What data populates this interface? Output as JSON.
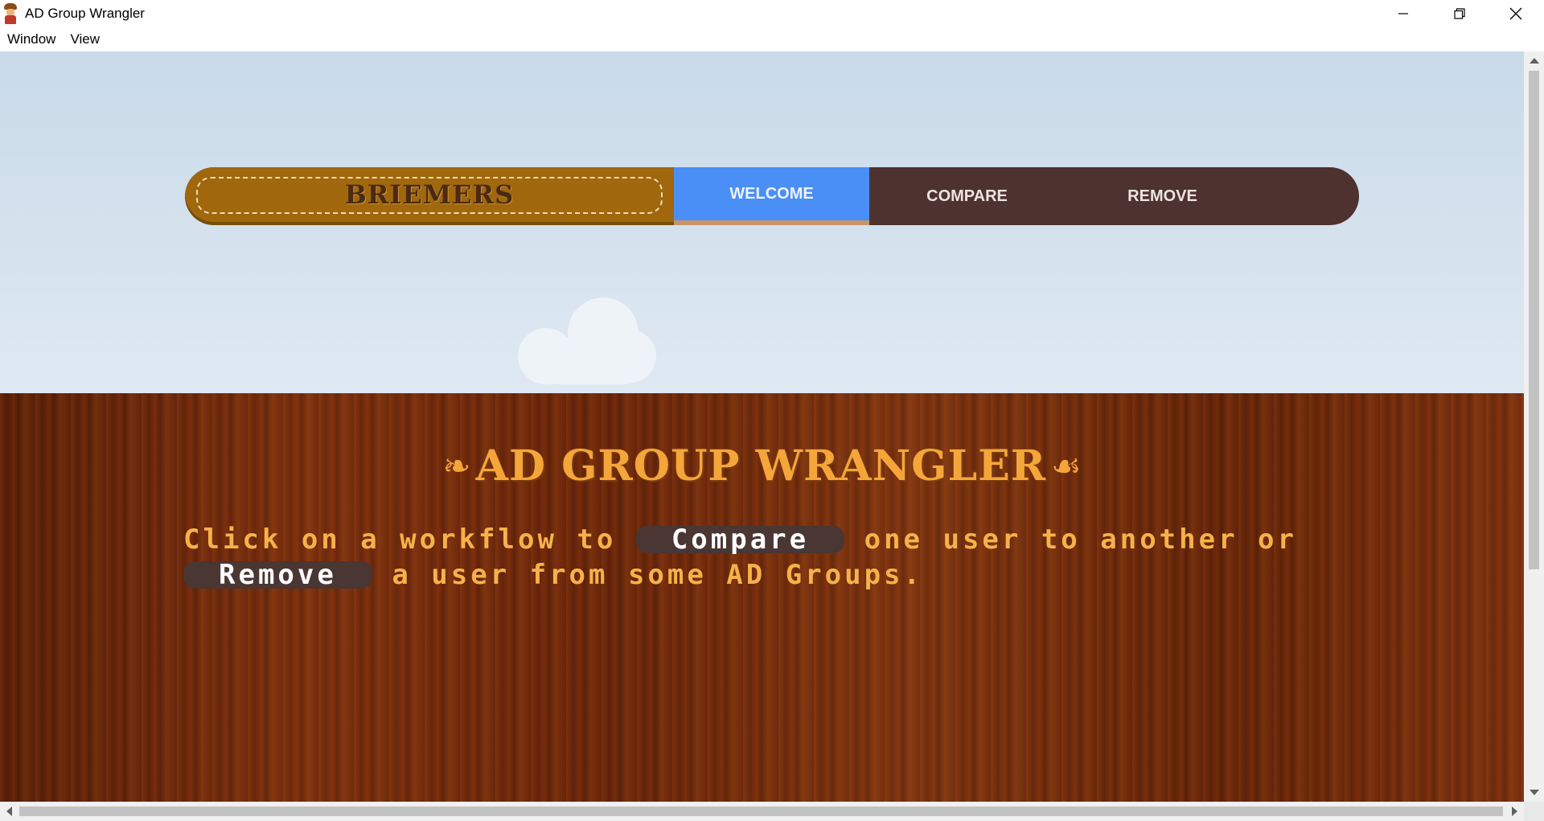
{
  "window": {
    "title": "AD Group Wrangler",
    "controls": [
      "minimize-icon",
      "restore-icon",
      "close-icon"
    ]
  },
  "menubar": {
    "items": [
      {
        "label": "Window"
      },
      {
        "label": "View"
      }
    ]
  },
  "nav": {
    "brand": "BRIEMERS",
    "tabs": [
      {
        "label": "WELCOME",
        "active": true
      },
      {
        "label": "COMPARE",
        "active": false
      },
      {
        "label": "REMOVE",
        "active": false
      }
    ]
  },
  "hero": {
    "title": "AD GROUP WRANGLER",
    "desc_1": "Click on a workflow to",
    "compare_btn": "Compare",
    "desc_2": "one user to",
    "desc_3": "another or",
    "remove_btn": "Remove",
    "desc_4": "a user from some AD Groups."
  },
  "colors": {
    "nav_bg": "#4e3230",
    "brand_bg": "#a0670c",
    "active_tab": "#4a8ff5",
    "title_orange": "#f5a63a",
    "wood": "#6a250a"
  }
}
